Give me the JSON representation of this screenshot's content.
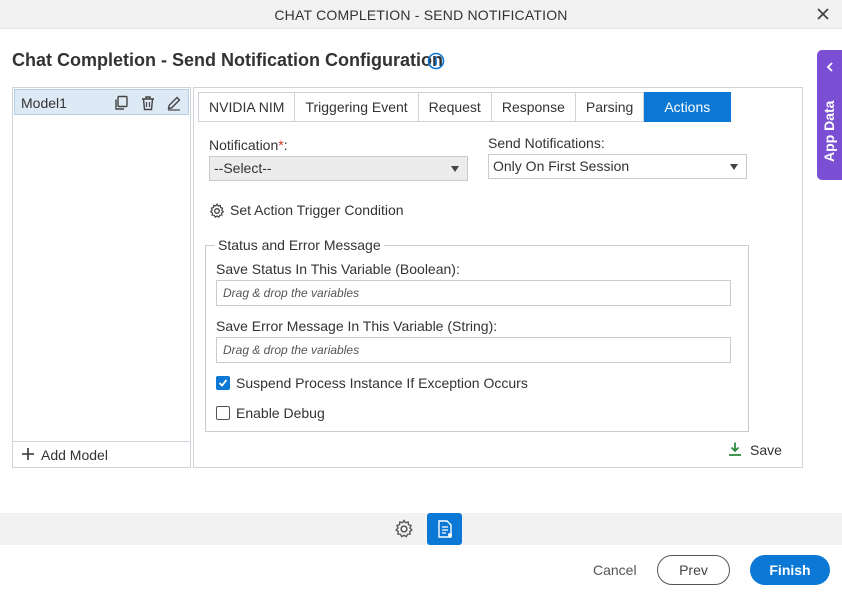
{
  "dialog": {
    "title": "CHAT COMPLETION - SEND NOTIFICATION",
    "heading": "Chat Completion - Send Notification Configuration"
  },
  "app_data": {
    "label": "App Data",
    "accent_color": "#7b4fd4"
  },
  "models": {
    "items": [
      {
        "label": "Model1"
      }
    ],
    "add_label": "Add Model"
  },
  "tabs": [
    {
      "label": "NVIDIA NIM",
      "active": false
    },
    {
      "label": "Triggering Event",
      "active": false
    },
    {
      "label": "Request",
      "active": false
    },
    {
      "label": "Response",
      "active": false
    },
    {
      "label": "Parsing",
      "active": false
    },
    {
      "label": "Actions",
      "active": true
    }
  ],
  "actions": {
    "notification_label": "Notification",
    "required_marker": "*",
    "label_colon": ":",
    "notification_value": "--Select--",
    "send_notifications_label": "Send Notifications:",
    "send_notifications_value": "Only On First Session",
    "trigger_condition_label": "Set Action Trigger Condition",
    "status_group_title": "Status and Error Message",
    "save_status_label": "Save Status In This Variable (Boolean):",
    "save_status_placeholder": "Drag & drop the variables",
    "save_error_label": "Save Error Message In This Variable (String):",
    "save_error_placeholder": "Drag & drop the variables",
    "suspend_label": "Suspend Process Instance If Exception Occurs",
    "suspend_checked": true,
    "debug_label": "Enable Debug",
    "debug_checked": false,
    "save_label": "Save"
  },
  "footer": {
    "cancel_label": "Cancel",
    "prev_label": "Prev",
    "finish_label": "Finish"
  },
  "colors": {
    "primary": "#0a78d4",
    "required": "#d9332b",
    "save_icon": "#2e8b3e"
  }
}
